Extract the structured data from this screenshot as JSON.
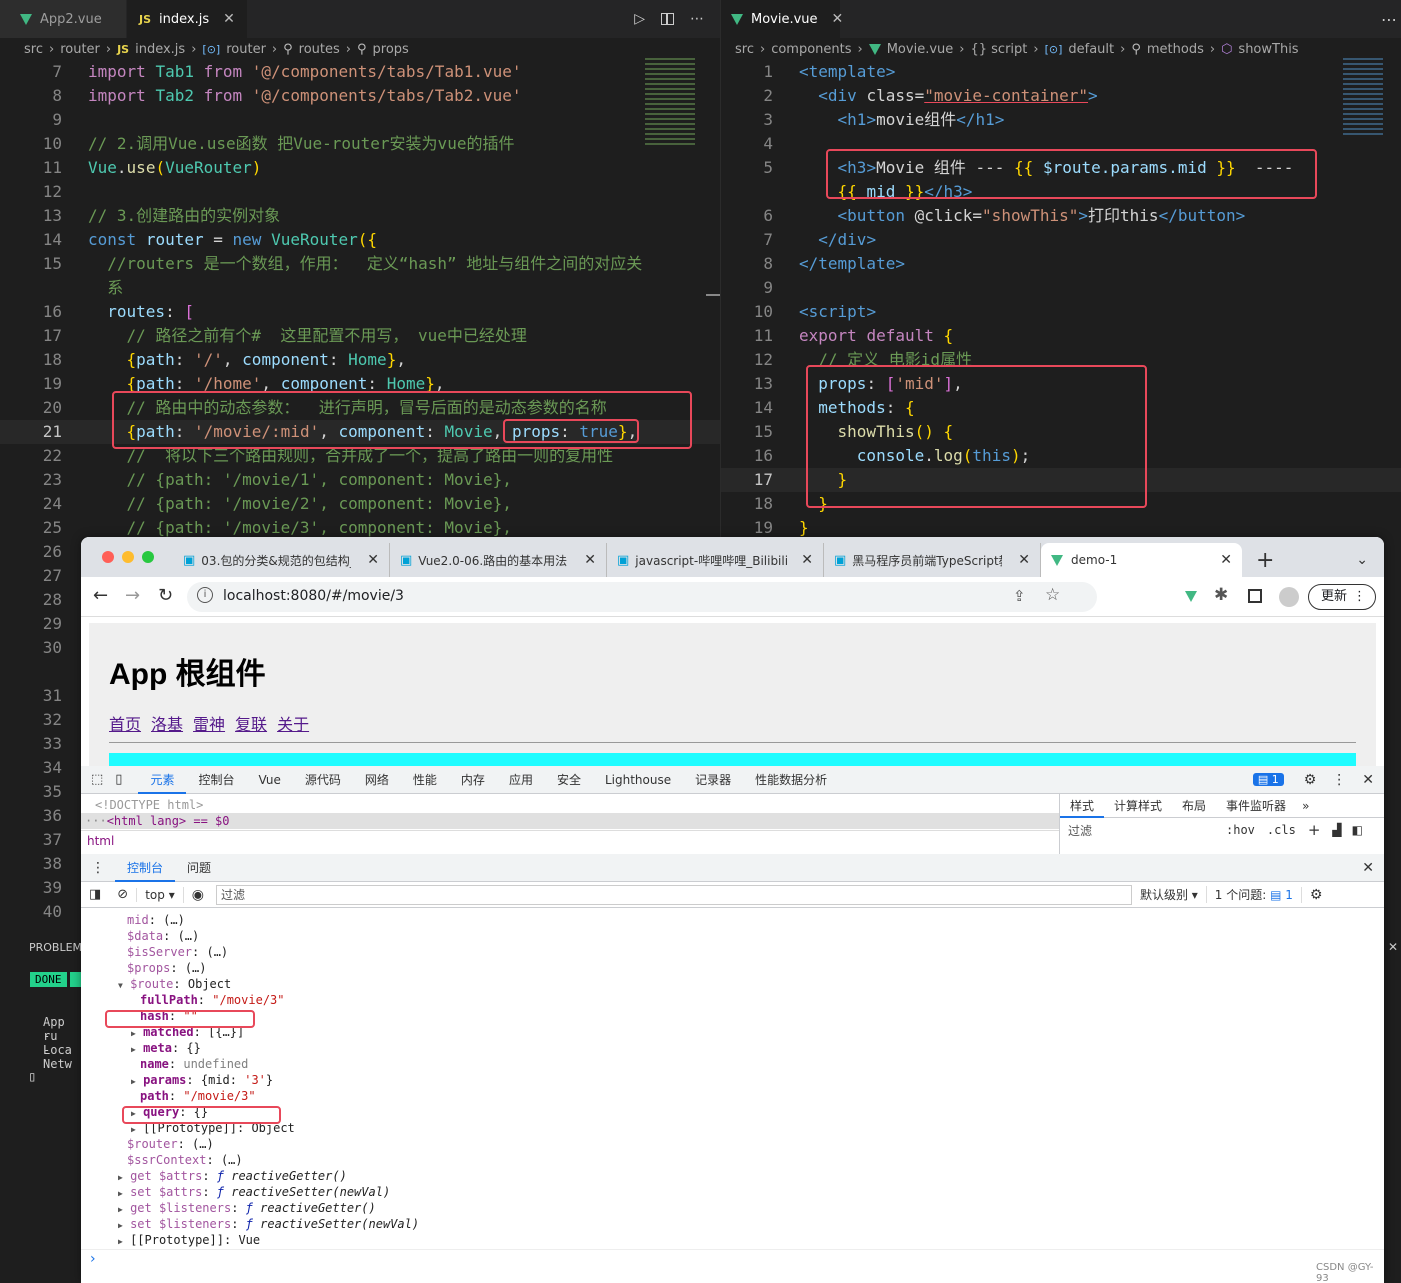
{
  "left_editor": {
    "tabs": [
      {
        "label": "App2.vue",
        "icon": "vue",
        "active": false
      },
      {
        "label": "index.js",
        "icon": "js",
        "active": true
      }
    ],
    "breadcrumb": [
      "src",
      "router",
      "index.js",
      "router",
      "routes",
      "props"
    ],
    "js_badge": "JS",
    "lines": [
      {
        "n": "7",
        "text": "import Tab1 from '@/components/tabs/Tab1.vue'"
      },
      {
        "n": "8",
        "text": "import Tab2 from '@/components/tabs/Tab2.vue'"
      },
      {
        "n": "9",
        "text": ""
      },
      {
        "n": "10",
        "text": "// 2.调用Vue.use函数 把Vue-router安装为vue的插件"
      },
      {
        "n": "11",
        "text": "Vue.use(VueRouter)"
      },
      {
        "n": "12",
        "text": ""
      },
      {
        "n": "13",
        "text": "// 3.创建路由的实例对象"
      },
      {
        "n": "14",
        "text": "const router = new VueRouter({"
      },
      {
        "n": "15",
        "text": "  //routers 是一个数组，作用：  定义“hash” 地址与组件之间的对应关"
      },
      {
        "n": "",
        "text": "  系"
      },
      {
        "n": "16",
        "text": "  routes: ["
      },
      {
        "n": "17",
        "text": "    // 路径之前有个#  这里配置不用写， vue中已经处理"
      },
      {
        "n": "18",
        "text": "    {path: '/', component: Home},"
      },
      {
        "n": "19",
        "text": "    {path: '/home', component: Home},"
      },
      {
        "n": "20",
        "text": "    // 路由中的动态参数：  进行声明，冒号后面的是动态参数的名称"
      },
      {
        "n": "21",
        "text": "    {path: '/movie/:mid', component: Movie, props: true},"
      },
      {
        "n": "22",
        "text": "    //  将以下三个路由规则，合并成了一个，提高了路由一则的复用性"
      },
      {
        "n": "23",
        "text": "    // {path: '/movie/1', component: Movie},"
      },
      {
        "n": "24",
        "text": "    // {path: '/movie/2', component: Movie},"
      },
      {
        "n": "25",
        "text": "    // {path: '/movie/3', component: Movie},"
      },
      {
        "n": "26",
        "text": ""
      },
      {
        "n": "27",
        "text": ""
      },
      {
        "n": "28",
        "text": ""
      },
      {
        "n": "29",
        "text": ""
      },
      {
        "n": "30",
        "text": ""
      },
      {
        "n": "",
        "text": ""
      },
      {
        "n": "31",
        "text": ""
      },
      {
        "n": "32",
        "text": ""
      },
      {
        "n": "33",
        "text": ""
      },
      {
        "n": "34",
        "text": ""
      },
      {
        "n": "35",
        "text": ""
      },
      {
        "n": "36",
        "text": ""
      },
      {
        "n": "37",
        "text": ""
      },
      {
        "n": "38",
        "text": ""
      },
      {
        "n": "39",
        "text": ""
      },
      {
        "n": "40",
        "text": ""
      }
    ]
  },
  "right_editor": {
    "tabs": [
      {
        "label": "Movie.vue",
        "icon": "vue",
        "active": true
      }
    ],
    "breadcrumb": [
      "src",
      "components",
      "Movie.vue",
      "{} script",
      "default",
      "methods",
      "showThis"
    ],
    "lines": [
      {
        "n": "1",
        "text": "<template>"
      },
      {
        "n": "2",
        "text": "  <div class=\"movie-container\">"
      },
      {
        "n": "3",
        "text": "    <h1>movie组件</h1>"
      },
      {
        "n": "4",
        "text": ""
      },
      {
        "n": "5",
        "text": "    <h3>Movie 组件 --- {{ $route.params.mid }}  ----"
      },
      {
        "n": "",
        "text": "    {{ mid }}</h3>"
      },
      {
        "n": "6",
        "text": "    <button @click=\"showThis\">打印this</button>"
      },
      {
        "n": "7",
        "text": "  </div>"
      },
      {
        "n": "8",
        "text": "</template>"
      },
      {
        "n": "9",
        "text": ""
      },
      {
        "n": "10",
        "text": "<script>"
      },
      {
        "n": "11",
        "text": "export default {"
      },
      {
        "n": "12",
        "text": "  // 定义 电影id属性"
      },
      {
        "n": "13",
        "text": "  props: ['mid'],"
      },
      {
        "n": "14",
        "text": "  methods: {"
      },
      {
        "n": "15",
        "text": "    showThis() {"
      },
      {
        "n": "16",
        "text": "      console.log(this);"
      },
      {
        "n": "17",
        "text": "    }"
      },
      {
        "n": "18",
        "text": "  }"
      },
      {
        "n": "19",
        "text": "}"
      }
    ]
  },
  "terminal": {
    "problems_label": "PROBLEM",
    "done_badge": "DONE",
    "lines": [
      "App ru",
      "- Loca",
      "- Netw"
    ],
    "cursor": "▯"
  },
  "browser": {
    "tabs": [
      "03.包的分类&规范的包结构_",
      "Vue2.0-06.路由的基本用法",
      "javascript-哔哩哔哩_Bilibili",
      "黑马程序员前端TypeScript教",
      "demo-1"
    ],
    "new_tab": "+",
    "url": "localhost:8080/#/movie/3",
    "update_button": "更新",
    "page": {
      "title": "App 根组件",
      "links": [
        "首页",
        "洛基",
        "雷神",
        "复联",
        "关于"
      ]
    },
    "devtools": {
      "tabs": [
        "元素",
        "控制台",
        "Vue",
        "源代码",
        "网络",
        "性能",
        "内存",
        "应用",
        "安全",
        "Lighthouse",
        "记录器",
        "性能数据分析"
      ],
      "issue_count": "1",
      "elements_lines": [
        "<!DOCTYPE html>",
        "<html lang> == $0",
        "html"
      ],
      "styles_tabs": [
        "样式",
        "计算样式",
        "布局",
        "事件监听器",
        "»"
      ],
      "styles_filter": "过滤",
      "styles_hov": ":hov",
      "styles_cls": ".cls",
      "drawer_tabs": [
        "控制台",
        "问题"
      ],
      "console_context": "top",
      "console_filter": "过滤",
      "console_level": "默认级别",
      "console_issues": "1 个问题:",
      "console_issues_count": "1",
      "console_lines": [
        {
          "indent": 0,
          "arrow": "",
          "key": "mid",
          "sep": ": ",
          "val": "(…)",
          "style": "dim"
        },
        {
          "indent": 0,
          "arrow": "",
          "key": "$data",
          "sep": ": ",
          "val": "(…)",
          "style": "dim"
        },
        {
          "indent": 0,
          "arrow": "",
          "key": "$isServer",
          "sep": ": ",
          "val": "(…)",
          "style": "dim"
        },
        {
          "indent": 0,
          "arrow": "",
          "key": "$props",
          "sep": ": ",
          "val": "(…)",
          "style": "dim"
        },
        {
          "indent": 0,
          "arrow": "▼",
          "key": "$route",
          "sep": ": ",
          "val": "Object",
          "style": "dim"
        },
        {
          "indent": 1,
          "arrow": "",
          "key": "fullPath",
          "sep": ": ",
          "val": "\"/movie/3\"",
          "style": "strong"
        },
        {
          "indent": 1,
          "arrow": "",
          "key": "hash",
          "sep": ": ",
          "val": "\"\"",
          "style": "strong"
        },
        {
          "indent": 1,
          "arrow": "▶",
          "key": "matched",
          "sep": ": ",
          "val": "[{…}]",
          "style": "strong"
        },
        {
          "indent": 1,
          "arrow": "▶",
          "key": "meta",
          "sep": ": ",
          "val": "{}",
          "style": "strong"
        },
        {
          "indent": 1,
          "arrow": "",
          "key": "name",
          "sep": ": ",
          "val": "undefined",
          "style": "strong"
        },
        {
          "indent": 1,
          "arrow": "▶",
          "key": "params",
          "sep": ": ",
          "val": "{mid: '3'}",
          "style": "strong"
        },
        {
          "indent": 1,
          "arrow": "",
          "key": "path",
          "sep": ": ",
          "val": "\"/movie/3\"",
          "style": "strong"
        },
        {
          "indent": 1,
          "arrow": "▶",
          "key": "query",
          "sep": ": ",
          "val": "{}",
          "style": "strong"
        },
        {
          "indent": 1,
          "arrow": "▶",
          "key": "[[Prototype]]",
          "sep": ": ",
          "val": "Object",
          "style": "plain"
        },
        {
          "indent": 0,
          "arrow": "",
          "key": "$router",
          "sep": ": ",
          "val": "(…)",
          "style": "dim"
        },
        {
          "indent": 0,
          "arrow": "",
          "key": "$ssrContext",
          "sep": ": ",
          "val": "(…)",
          "style": "dim"
        },
        {
          "indent": 0,
          "arrow": "▶",
          "key": "get $attrs",
          "sep": ": ",
          "val": "ƒ reactiveGetter()",
          "style": "fn"
        },
        {
          "indent": 0,
          "arrow": "▶",
          "key": "set $attrs",
          "sep": ": ",
          "val": "ƒ reactiveSetter(newVal)",
          "style": "fn"
        },
        {
          "indent": 0,
          "arrow": "▶",
          "key": "get $listeners",
          "sep": ": ",
          "val": "ƒ reactiveGetter()",
          "style": "fn"
        },
        {
          "indent": 0,
          "arrow": "▶",
          "key": "set $listeners",
          "sep": ": ",
          "val": "ƒ reactiveSetter(newVal)",
          "style": "fn"
        },
        {
          "indent": 0,
          "arrow": "▶",
          "key": "[[Prototype]]",
          "sep": ": ",
          "val": "Vue",
          "style": "plain"
        }
      ],
      "prompt": "›"
    }
  },
  "watermark": "CSDN @GY-93",
  "colors": {
    "highlight_box": "#e8485a",
    "cyan_bar": "#1ffcff",
    "vue_green": "#41b883",
    "devtools_blue": "#1a73e8"
  }
}
